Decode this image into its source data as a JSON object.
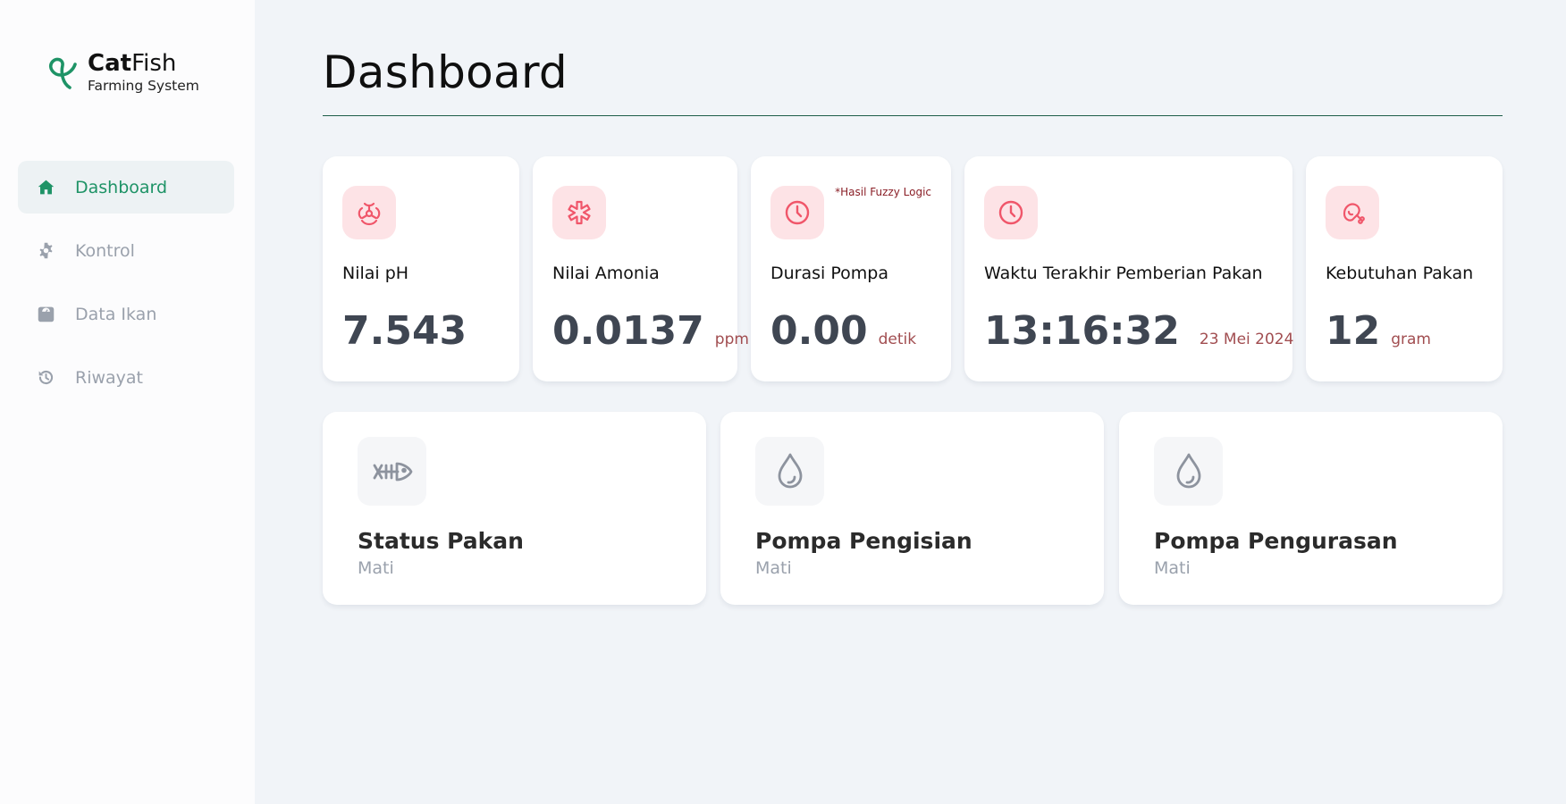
{
  "brand": {
    "title_bold": "Cat",
    "title_regular": "Fish",
    "subtitle": "Farming System",
    "accent_color": "#1e9366"
  },
  "sidebar": {
    "items": [
      {
        "label": "Dashboard",
        "icon": "home-icon",
        "active": true
      },
      {
        "label": "Kontrol",
        "icon": "gear-icon",
        "active": false
      },
      {
        "label": "Data Ikan",
        "icon": "scale-icon",
        "active": false
      },
      {
        "label": "Riwayat",
        "icon": "history-icon",
        "active": false
      }
    ]
  },
  "page": {
    "title": "Dashboard"
  },
  "stats": [
    {
      "label": "Nilai pH",
      "value": "7.543",
      "unit": "",
      "icon": "biohazard-icon"
    },
    {
      "label": "Nilai Amonia",
      "value": "0.0137",
      "unit": "ppm",
      "icon": "asterisk-icon"
    },
    {
      "label": "Durasi Pompa",
      "value": "0.00",
      "unit": "detik",
      "icon": "clock-icon",
      "note": "*Hasil Fuzzy Logic"
    },
    {
      "label": "Waktu Terakhir Pemberian Pakan",
      "value": "13:16:32",
      "unit": "23 Mei 2024",
      "icon": "clock-icon"
    },
    {
      "label": "Kebutuhan Pakan",
      "value": "12",
      "unit": "gram",
      "icon": "meat-icon"
    }
  ],
  "statuses": [
    {
      "title": "Status Pakan",
      "value": "Mati",
      "icon": "fish-bone-icon"
    },
    {
      "title": "Pompa Pengisian",
      "value": "Mati",
      "icon": "water-drop-icon"
    },
    {
      "title": "Pompa Pengurasan",
      "value": "Mati",
      "icon": "water-drop-icon"
    }
  ],
  "colors": {
    "stat_icon_bg": "#fde3e6",
    "stat_icon_fg": "#f0566a",
    "value_text": "#3f4652",
    "unit_text": "#a14d50",
    "muted_text": "#9aa1ac"
  }
}
